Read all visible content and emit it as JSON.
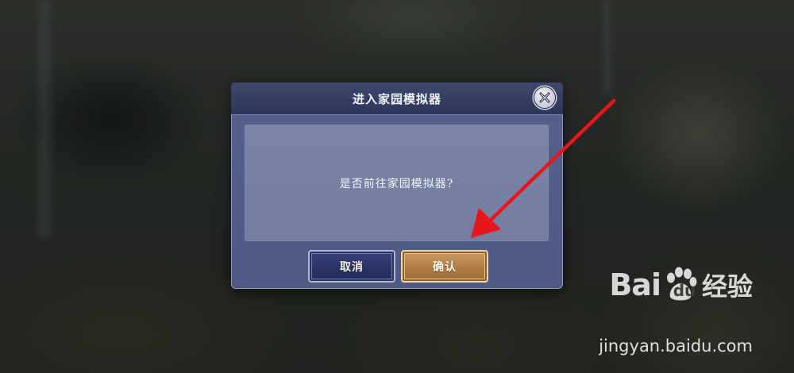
{
  "dialog": {
    "title": "进入家园模拟器",
    "message": "是否前往家园模拟器?",
    "cancel_label": "取消",
    "confirm_label": "确认",
    "close_icon": "close-icon"
  },
  "watermark": {
    "logo_text": "Bai",
    "logo_du": "du",
    "logo_suffix": "经验",
    "url": "jingyan.baidu.com"
  },
  "colors": {
    "header": "#2e3657",
    "panel": "#56628c",
    "content": "#7a84a5",
    "cancel_button": "#2a3466",
    "confirm_button": "#b07c45",
    "annotation_arrow": "#e8161b"
  }
}
